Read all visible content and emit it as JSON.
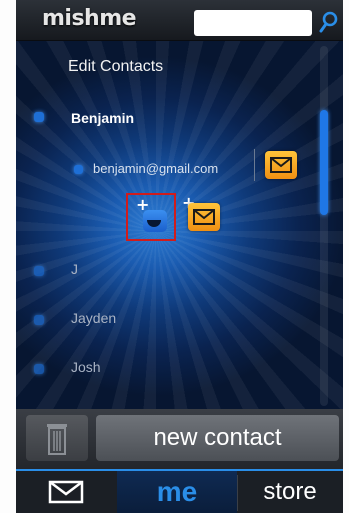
{
  "app": {
    "logo": "mishme"
  },
  "search": {
    "value": "",
    "placeholder": ""
  },
  "screen": {
    "title": "Edit Contacts"
  },
  "contacts": [
    {
      "name": "Benjamin",
      "selected": true,
      "email": "benjamin@gmail.com"
    },
    {
      "name": "J",
      "selected": false
    },
    {
      "name": "Jayden",
      "selected": false
    },
    {
      "name": "Josh",
      "selected": false
    }
  ],
  "icons": {
    "search": "search-icon",
    "mail": "envelope-icon",
    "trash": "trash-icon",
    "add": "plus-icon",
    "me": "me-face-icon"
  },
  "actions": {
    "new_contact_label": "new contact"
  },
  "tabs": {
    "me_label": "me",
    "store_label": "store"
  },
  "colors": {
    "accent": "#1f77e6",
    "mail_button": "#f6a623",
    "highlight_box": "#d01c1c"
  }
}
